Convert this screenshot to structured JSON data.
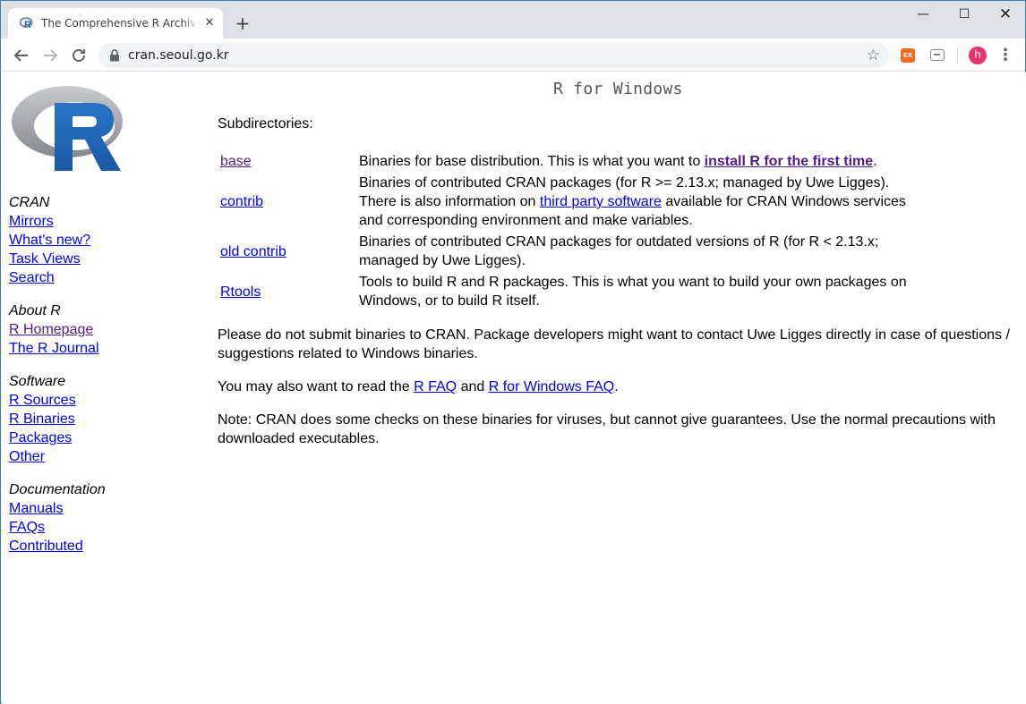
{
  "browser": {
    "tab_title": "The Comprehensive R Archive Network",
    "tab_close": "✕",
    "new_tab": "+",
    "url": "cran.seoul.go.kr",
    "window_controls": {
      "minimize": "—",
      "maximize": "☐",
      "close": "✕"
    },
    "extension_label": "EX",
    "avatar_letter": "h",
    "icons": [
      "back-arrow-icon",
      "forward-arrow-icon",
      "reload-icon",
      "lock-icon",
      "star-icon",
      "menu-dots-icon"
    ]
  },
  "sidebar": {
    "groups": [
      {
        "heading": "CRAN",
        "links": [
          "Mirrors",
          "What's new?",
          "Task Views",
          "Search"
        ]
      },
      {
        "heading": "About R",
        "links": [
          "R Homepage",
          "The R Journal"
        ]
      },
      {
        "heading": "Software",
        "links": [
          "R Sources",
          "R Binaries",
          "Packages",
          "Other"
        ]
      },
      {
        "heading": "Documentation",
        "links": [
          "Manuals",
          "FAQs",
          "Contributed"
        ]
      }
    ]
  },
  "main": {
    "title": "R for Windows",
    "subdirectories_label": "Subdirectories:",
    "rows": [
      {
        "name": "base",
        "desc_before": "Binaries for base distribution. This is what you want to ",
        "desc_link": "install R for the first time",
        "desc_after": "."
      },
      {
        "name": "contrib",
        "desc_line1": "Binaries of contributed CRAN packages (for R >= 2.13.x; managed by Uwe Ligges).",
        "desc_before": "There is also information on ",
        "desc_link": "third party software",
        "desc_after": " available for CRAN Windows services and corresponding environment and make variables."
      },
      {
        "name": "old contrib",
        "desc": "Binaries of contributed CRAN packages for outdated versions of R (for R < 2.13.x; managed by Uwe Ligges)."
      },
      {
        "name": "Rtools",
        "desc": "Tools to build R and R packages. This is what you want to build your own packages on Windows, or to build R itself."
      }
    ],
    "para1": "Please do not submit binaries to CRAN. Package developers might want to contact Uwe Ligges directly in case of questions / suggestions related to Windows binaries.",
    "para2_before": "You may also want to read the ",
    "para2_link1": "R FAQ",
    "para2_mid": " and ",
    "para2_link2": "R for Windows FAQ",
    "para2_after": ".",
    "para3": "Note: CRAN does some checks on these binaries for viruses, but cannot give guarantees. Use the normal precautions with downloaded executables."
  },
  "colors": {
    "link": "#0000ee",
    "visited_link": "#551a8b",
    "tabstrip": "#dee1e6",
    "omnibox": "#f1f3f4",
    "avatar": "#e8336d",
    "extension": "#f26b21",
    "logo_blue": "#1f65b7",
    "logo_gray": "#9a9ca2"
  }
}
